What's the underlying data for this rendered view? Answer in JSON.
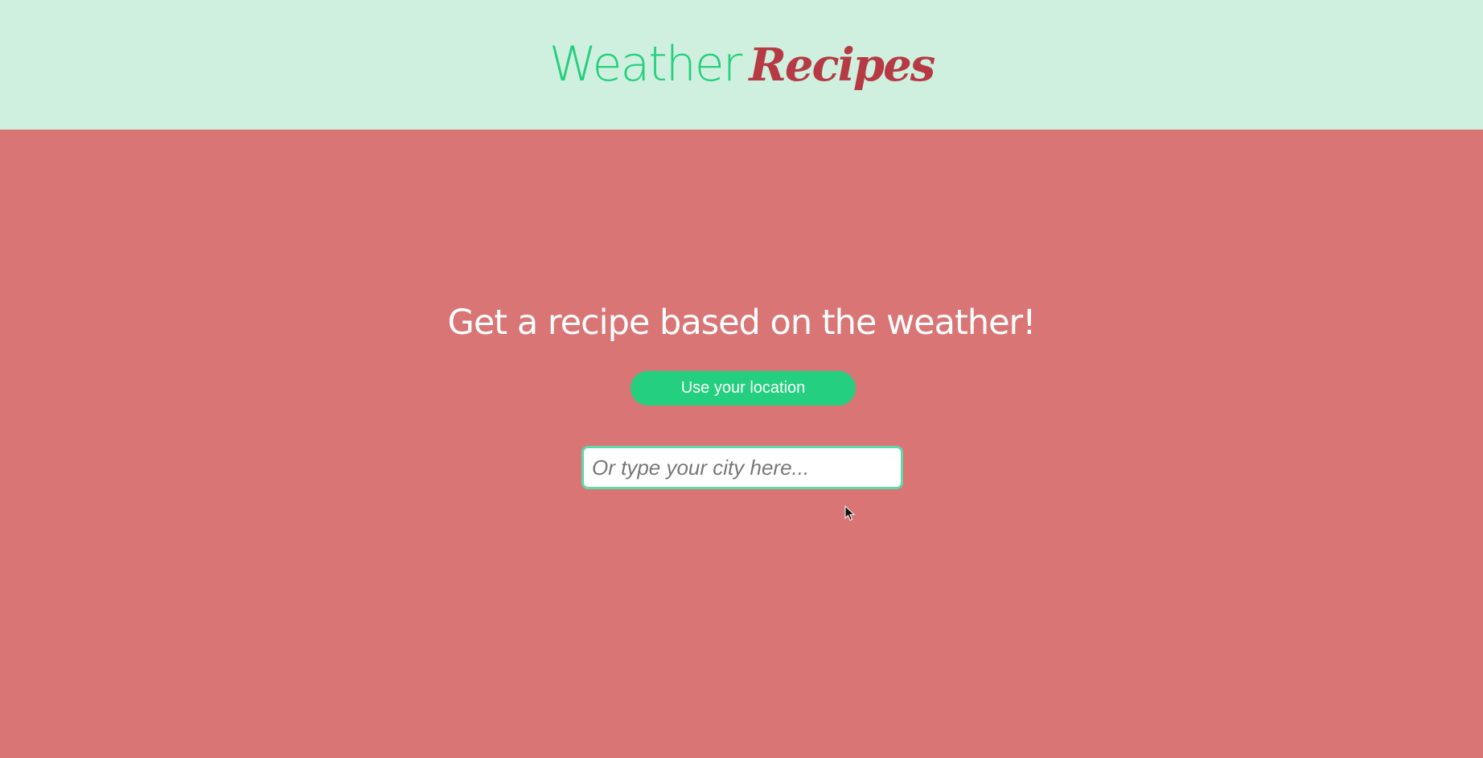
{
  "header": {
    "logo_part1": "Weather",
    "logo_part2": "Recipes"
  },
  "main": {
    "headline": "Get a recipe based on the weather!",
    "location_button_label": "Use your location",
    "city_input": {
      "value": "",
      "placeholder": "Or type your city here..."
    }
  },
  "colors": {
    "header_bg": "#cff0de",
    "main_bg": "#d97575",
    "accent_green": "#24cf7f",
    "brand_red": "#b53a44"
  },
  "icons": {
    "cursor": "mouse-pointer-icon"
  }
}
